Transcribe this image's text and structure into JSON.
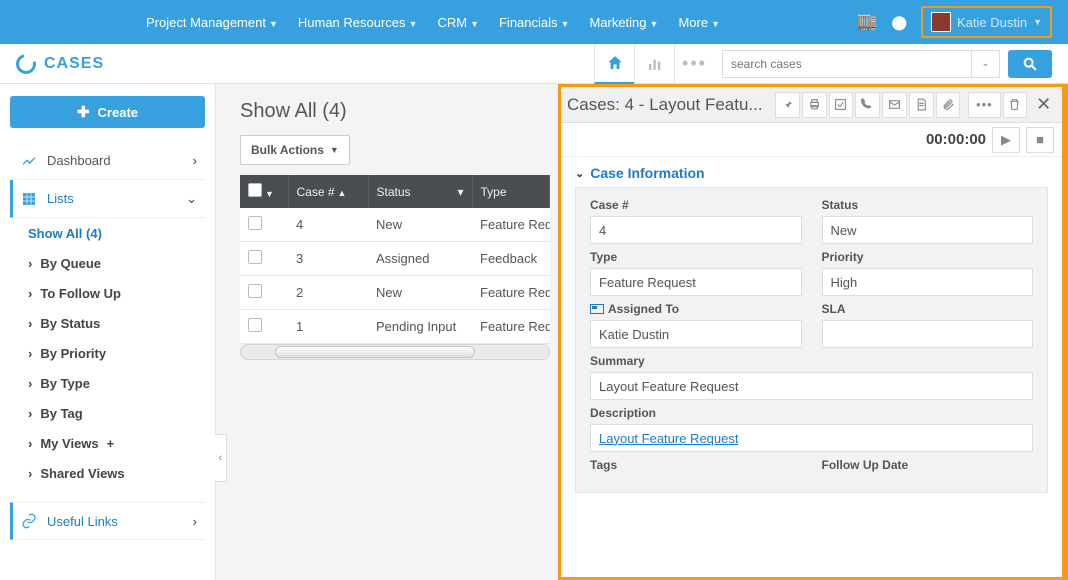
{
  "topnav": {
    "items": [
      "Project Management",
      "Human Resources",
      "CRM",
      "Financials",
      "Marketing",
      "More"
    ],
    "user": "Katie Dustin"
  },
  "logo": "CASES",
  "search_placeholder": "search cases",
  "create_label": "Create",
  "sidebar": {
    "dashboard": "Dashboard",
    "lists": "Lists",
    "show_all": "Show All (4)",
    "items": [
      "By Queue",
      "To Follow Up",
      "By Status",
      "By Priority",
      "By Type",
      "By Tag",
      "My Views",
      "Shared Views"
    ],
    "useful_links": "Useful Links"
  },
  "list": {
    "title": "Show All (4)",
    "bulk_label": "Bulk Actions",
    "columns": [
      "Case #",
      "Status",
      "Type"
    ],
    "rows": [
      {
        "case": "4",
        "status": "New",
        "type": "Feature Request"
      },
      {
        "case": "3",
        "status": "Assigned",
        "type": "Feedback"
      },
      {
        "case": "2",
        "status": "New",
        "type": "Feature Request"
      },
      {
        "case": "1",
        "status": "Pending Input",
        "type": "Feature Request"
      }
    ]
  },
  "detail": {
    "title": "Cases: 4 - Layout Featu...",
    "timer": "00:00:00",
    "section_title": "Case Information",
    "labels": {
      "case": "Case #",
      "status": "Status",
      "type": "Type",
      "priority": "Priority",
      "assigned": "Assigned To",
      "sla": "SLA",
      "summary": "Summary",
      "description": "Description",
      "tags": "Tags",
      "followup": "Follow Up Date"
    },
    "values": {
      "case": "4",
      "status": "New",
      "type": "Feature Request",
      "priority": "High",
      "assigned": "Katie Dustin",
      "sla": "",
      "summary": "Layout Feature Request",
      "description": "Layout Feature Request"
    }
  }
}
